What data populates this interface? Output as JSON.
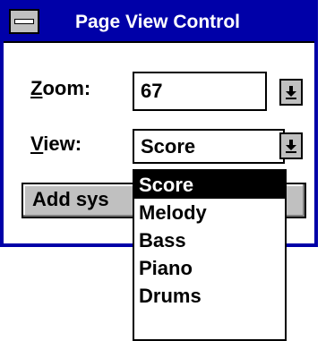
{
  "window": {
    "title": "Page View Control"
  },
  "zoom": {
    "label_accel": "Z",
    "label_rest": "oom:",
    "value": "67"
  },
  "view": {
    "label_accel": "V",
    "label_rest": "iew:",
    "selected": "Score",
    "options": [
      "Score",
      "Melody",
      "Bass",
      "Piano",
      "Drums"
    ]
  },
  "button": {
    "label": "Add sys"
  },
  "icons": {
    "system_menu": "system-menu-icon",
    "dropdown": "dropdown-arrow-icon"
  },
  "colors": {
    "title_bar": "#0000a8",
    "selection": "#000000",
    "button_face": "#c0c0c0"
  }
}
